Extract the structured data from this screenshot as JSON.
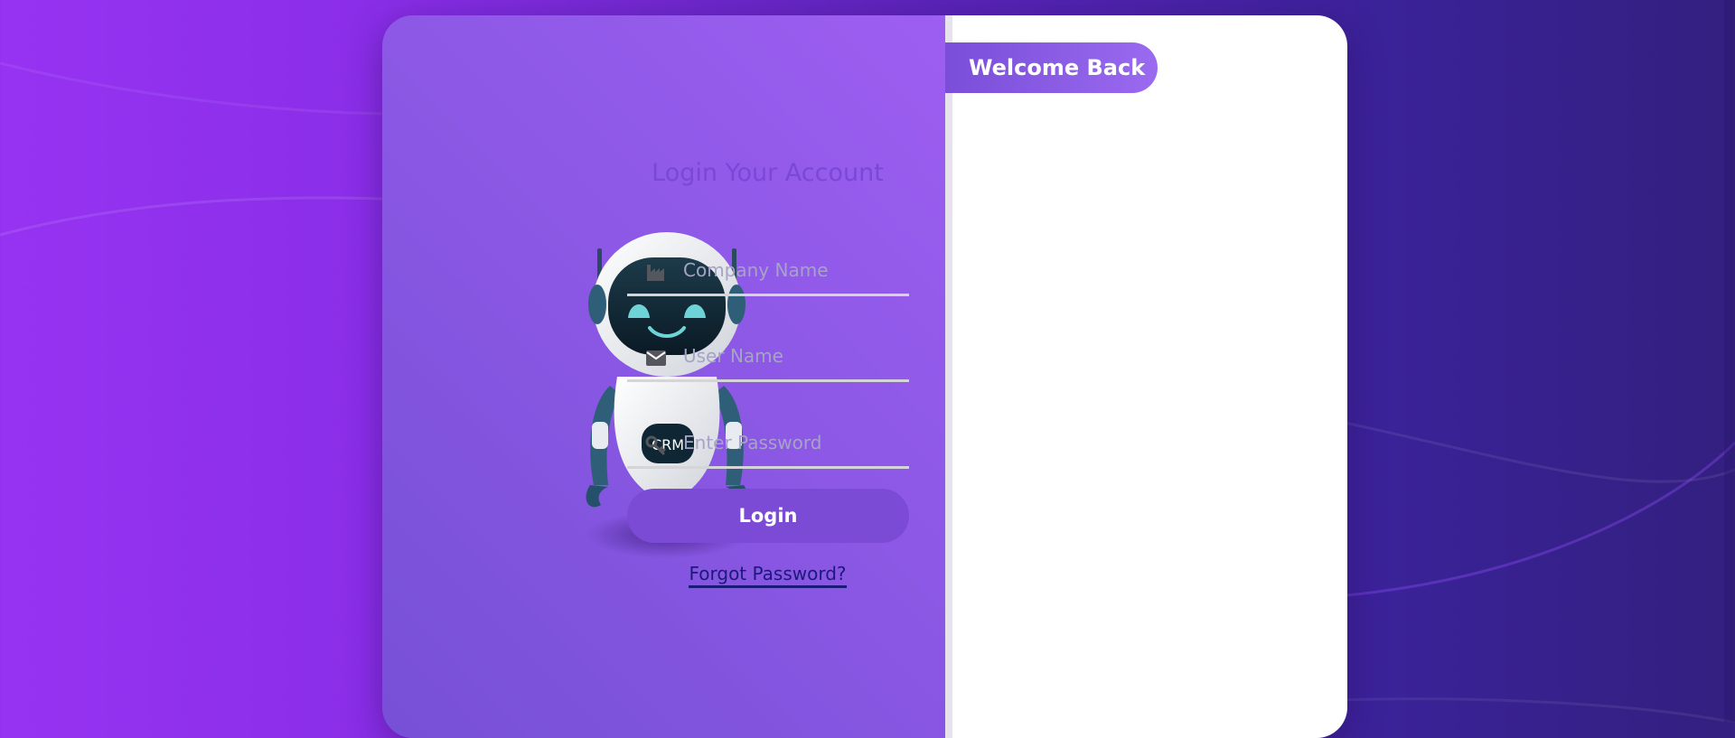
{
  "colors": {
    "accent": "#7b4bd6",
    "link": "#1b1a7a",
    "title": "#7a48d6",
    "placeholder": "#a6a3c8"
  },
  "brand": {
    "welcome_badge": "Welcome Back",
    "robot_badge": "CRM"
  },
  "login": {
    "title": "Login Your Account",
    "fields": [
      {
        "icon": "industry-icon",
        "placeholder": "Company Name"
      },
      {
        "icon": "envelope-icon",
        "placeholder": "User Name"
      },
      {
        "icon": "key-icon",
        "placeholder": "Enter Password"
      }
    ],
    "submit_label": "Login",
    "forgot_label": "Forgot Password?"
  }
}
